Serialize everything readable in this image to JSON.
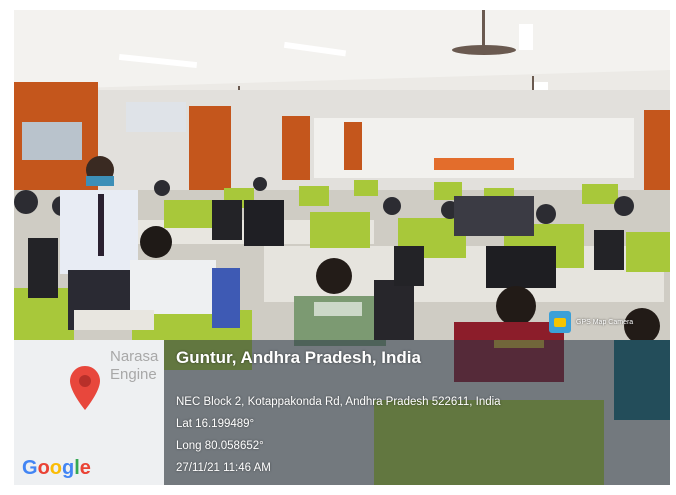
{
  "map": {
    "place_label_lines": [
      "Narasa",
      "Engine"
    ],
    "logo_text": "Google",
    "logo_colors": [
      "#4285F4",
      "#EA4335",
      "#FBBC05",
      "#4285F4",
      "#34A853",
      "#EA4335"
    ],
    "pin_color": "#e8473c"
  },
  "overlay": {
    "title": "Guntur, Andhra Pradesh, India",
    "address": "NEC Block 2, Kotappakonda Rd, Andhra Pradesh 522611, India",
    "latitude": "Lat 16.199489°",
    "longitude": "Long 80.058652°",
    "datetime": "27/11/21 11:46 AM"
  },
  "badge": {
    "label": "GPS Map Camera"
  },
  "scene": {
    "description_colors": {
      "monitor_green": "#a8c83a",
      "wall_orange": "#c4561c",
      "ceiling": "#efeeea"
    }
  }
}
